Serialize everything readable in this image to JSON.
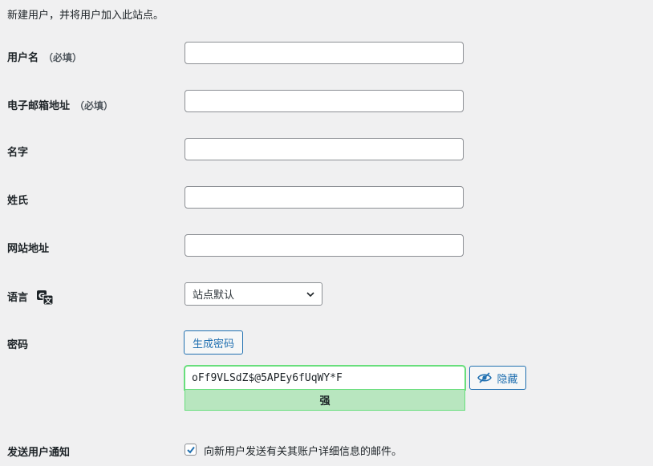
{
  "intro_text": "新建用户，并将用户加入此站点。",
  "required_suffix": "（必填）",
  "fields": {
    "username": {
      "label": "用户名",
      "value": ""
    },
    "email": {
      "label": "电子邮箱地址",
      "value": ""
    },
    "first_name": {
      "label": "名字",
      "value": ""
    },
    "last_name": {
      "label": "姓氏",
      "value": ""
    },
    "website": {
      "label": "网站地址",
      "value": ""
    }
  },
  "language": {
    "label": "语言",
    "icon": "translation-icon",
    "selected": "站点默认"
  },
  "password": {
    "label": "密码",
    "generate_label": "生成密码",
    "value": "oFf9VLSdZ$@5APEy6fUqWY*F",
    "strength": "强",
    "hide_label": "隐藏",
    "hide_icon": "eye-slash-icon"
  },
  "notify": {
    "label": "发送用户通知",
    "checkbox_label": "向新用户发送有关其账户详细信息的邮件。",
    "checked": true
  },
  "colors": {
    "accent": "#2271b1",
    "strength_bg": "#b8e6bf",
    "strength_border": "#68de7c"
  }
}
